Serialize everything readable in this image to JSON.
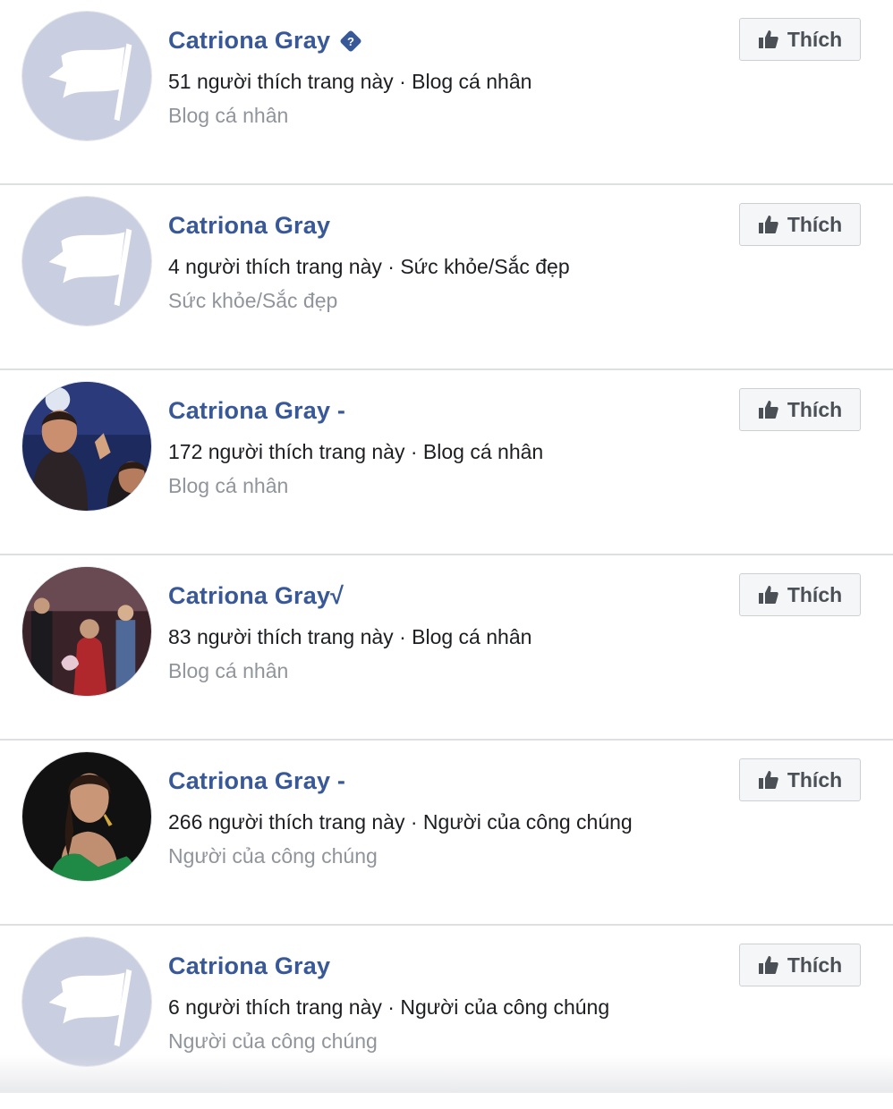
{
  "results": [
    {
      "name": "Catriona Gray",
      "verified_icon": "verified-badge-icon",
      "meta": "51 người thích trang này · Blog cá nhân",
      "category": "Blog cá nhân",
      "avatar": "flag-placeholder",
      "button": "Thích"
    },
    {
      "name": "Catriona Gray",
      "meta": "4 người thích trang này · Sức khỏe/Sắc đẹp",
      "category": "Sức khỏe/Sắc đẹp",
      "avatar": "flag-placeholder",
      "button": "Thích"
    },
    {
      "name": "Catriona Gray -",
      "meta": "172 người thích trang này · Blog cá nhân",
      "category": "Blog cá nhân",
      "avatar": "photo-crowning",
      "button": "Thích"
    },
    {
      "name": "Catriona Gray√",
      "meta": "83 người thích trang này · Blog cá nhân",
      "category": "Blog cá nhân",
      "avatar": "photo-stage",
      "button": "Thích"
    },
    {
      "name": "Catriona Gray -",
      "meta": "266 người thích trang này · Người của công chúng",
      "category": "Người của công chúng",
      "avatar": "photo-portrait-green",
      "button": "Thích"
    },
    {
      "name": "Catriona Gray",
      "meta": "6 người thích trang này · Người của công chúng",
      "category": "Người của công chúng",
      "avatar": "flag-placeholder",
      "button": "Thích"
    }
  ],
  "colors": {
    "name": "#385898",
    "meta": "#1c1e21",
    "category": "#90949c",
    "placeholder_bg": "#c9cee0"
  }
}
